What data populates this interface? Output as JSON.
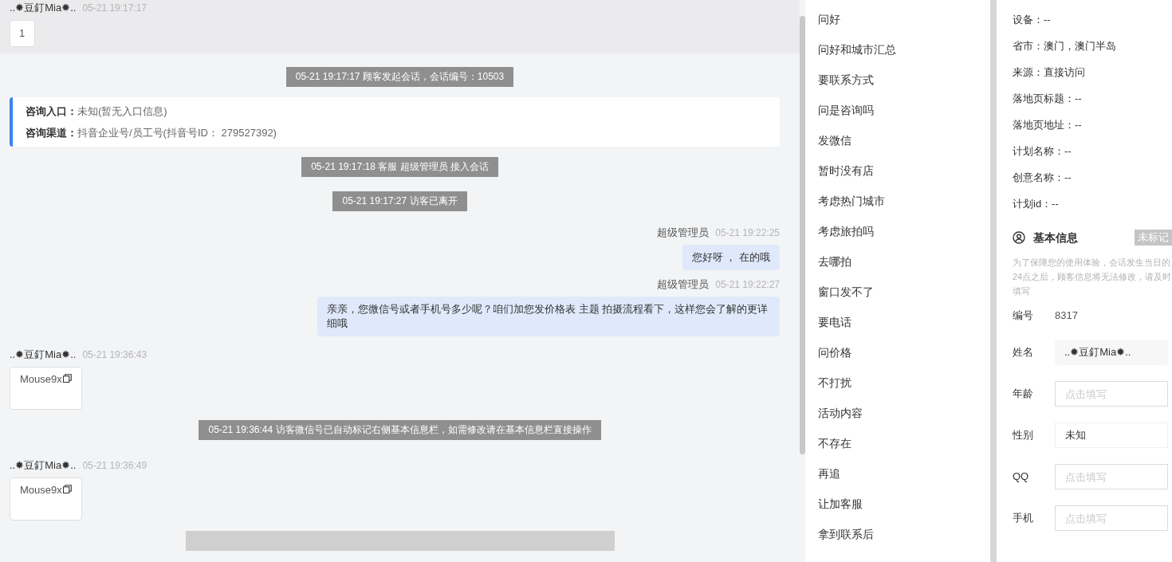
{
  "chat": {
    "messages": [
      {
        "kind": "visitor",
        "highlighted": true,
        "sender": "..✹豆釘Mia✹..",
        "time": "05-21 19:17:17",
        "content": "1",
        "copyable": false
      },
      {
        "kind": "system",
        "text": "05-21 19:17:17 顾客发起会话，会话编号：10503"
      },
      {
        "kind": "entry_info",
        "lines": [
          {
            "label": "咨询入口：",
            "value": "未知(暂无入口信息)"
          },
          {
            "label": "咨询渠道：",
            "value": "抖音企业号/员工号(抖音号ID：  279527392)"
          }
        ]
      },
      {
        "kind": "system",
        "text": "05-21 19:17:18 客服 超级管理员 接入会话"
      },
      {
        "kind": "system",
        "text": "05-21 19:17:27 访客已离开"
      },
      {
        "kind": "agent",
        "sender": "超级管理员",
        "time": "05-21 19:22:25",
        "content": "您好呀 ， 在的哦"
      },
      {
        "kind": "agent",
        "sender": "超级管理员",
        "time": "05-21 19:22:27",
        "content": "亲亲，您微信号或者手机号多少呢？咱们加您发价格表 主题 拍摄流程看下，这样您会了解的更详细哦"
      },
      {
        "kind": "visitor",
        "highlighted": false,
        "sender": "..✹豆釘Mia✹..",
        "time": "05-21 19:36:43",
        "content": "Mouse9x",
        "copyable": true
      },
      {
        "kind": "system",
        "text": "05-21 19:36:44 访客微信号已自动标记右侧基本信息栏，如需修改请在基本信息栏直接操作"
      },
      {
        "kind": "visitor",
        "highlighted": false,
        "sender": "..✹豆釘Mia✹..",
        "time": "05-21 19:36:49",
        "content": "Mouse9x",
        "copyable": true
      },
      {
        "kind": "bar"
      }
    ]
  },
  "quick_replies": [
    "问好",
    "问好和城市汇总",
    "要联系方式",
    "问是咨询吗",
    "发微信",
    "暂时没有店",
    "考虑热门城市",
    "考虑旅拍吗",
    "去哪拍",
    "窗口发不了",
    "要电话",
    "问价格",
    "不打扰",
    "活动内容",
    "不存在",
    "再追",
    "让加客服",
    "拿到联系后"
  ],
  "visitor_details": [
    "设备：--",
    "省市：澳门，澳门半岛",
    "来源：直接访问",
    "落地页标题：--",
    "落地页地址：--",
    "计划名称：--",
    "创意名称：--",
    "计划id：--"
  ],
  "basic_info": {
    "title": "基本信息",
    "badge": "未标记",
    "note": "为了保障您的使用体验，会话发生当日的24点之后，顾客信息将无法修改，请及时填写",
    "fields": [
      {
        "kind": "text",
        "label": "编号",
        "value": "8317"
      },
      {
        "kind": "filled",
        "label": "姓名",
        "value": "..✹豆釘Mia✹.."
      },
      {
        "kind": "input",
        "label": "年龄",
        "placeholder": "点击填写"
      },
      {
        "kind": "select",
        "label": "性别",
        "value": "未知"
      },
      {
        "kind": "input",
        "label": "QQ",
        "placeholder": "点击填写"
      },
      {
        "kind": "input",
        "label": "手机",
        "placeholder": "点击填写"
      }
    ]
  }
}
